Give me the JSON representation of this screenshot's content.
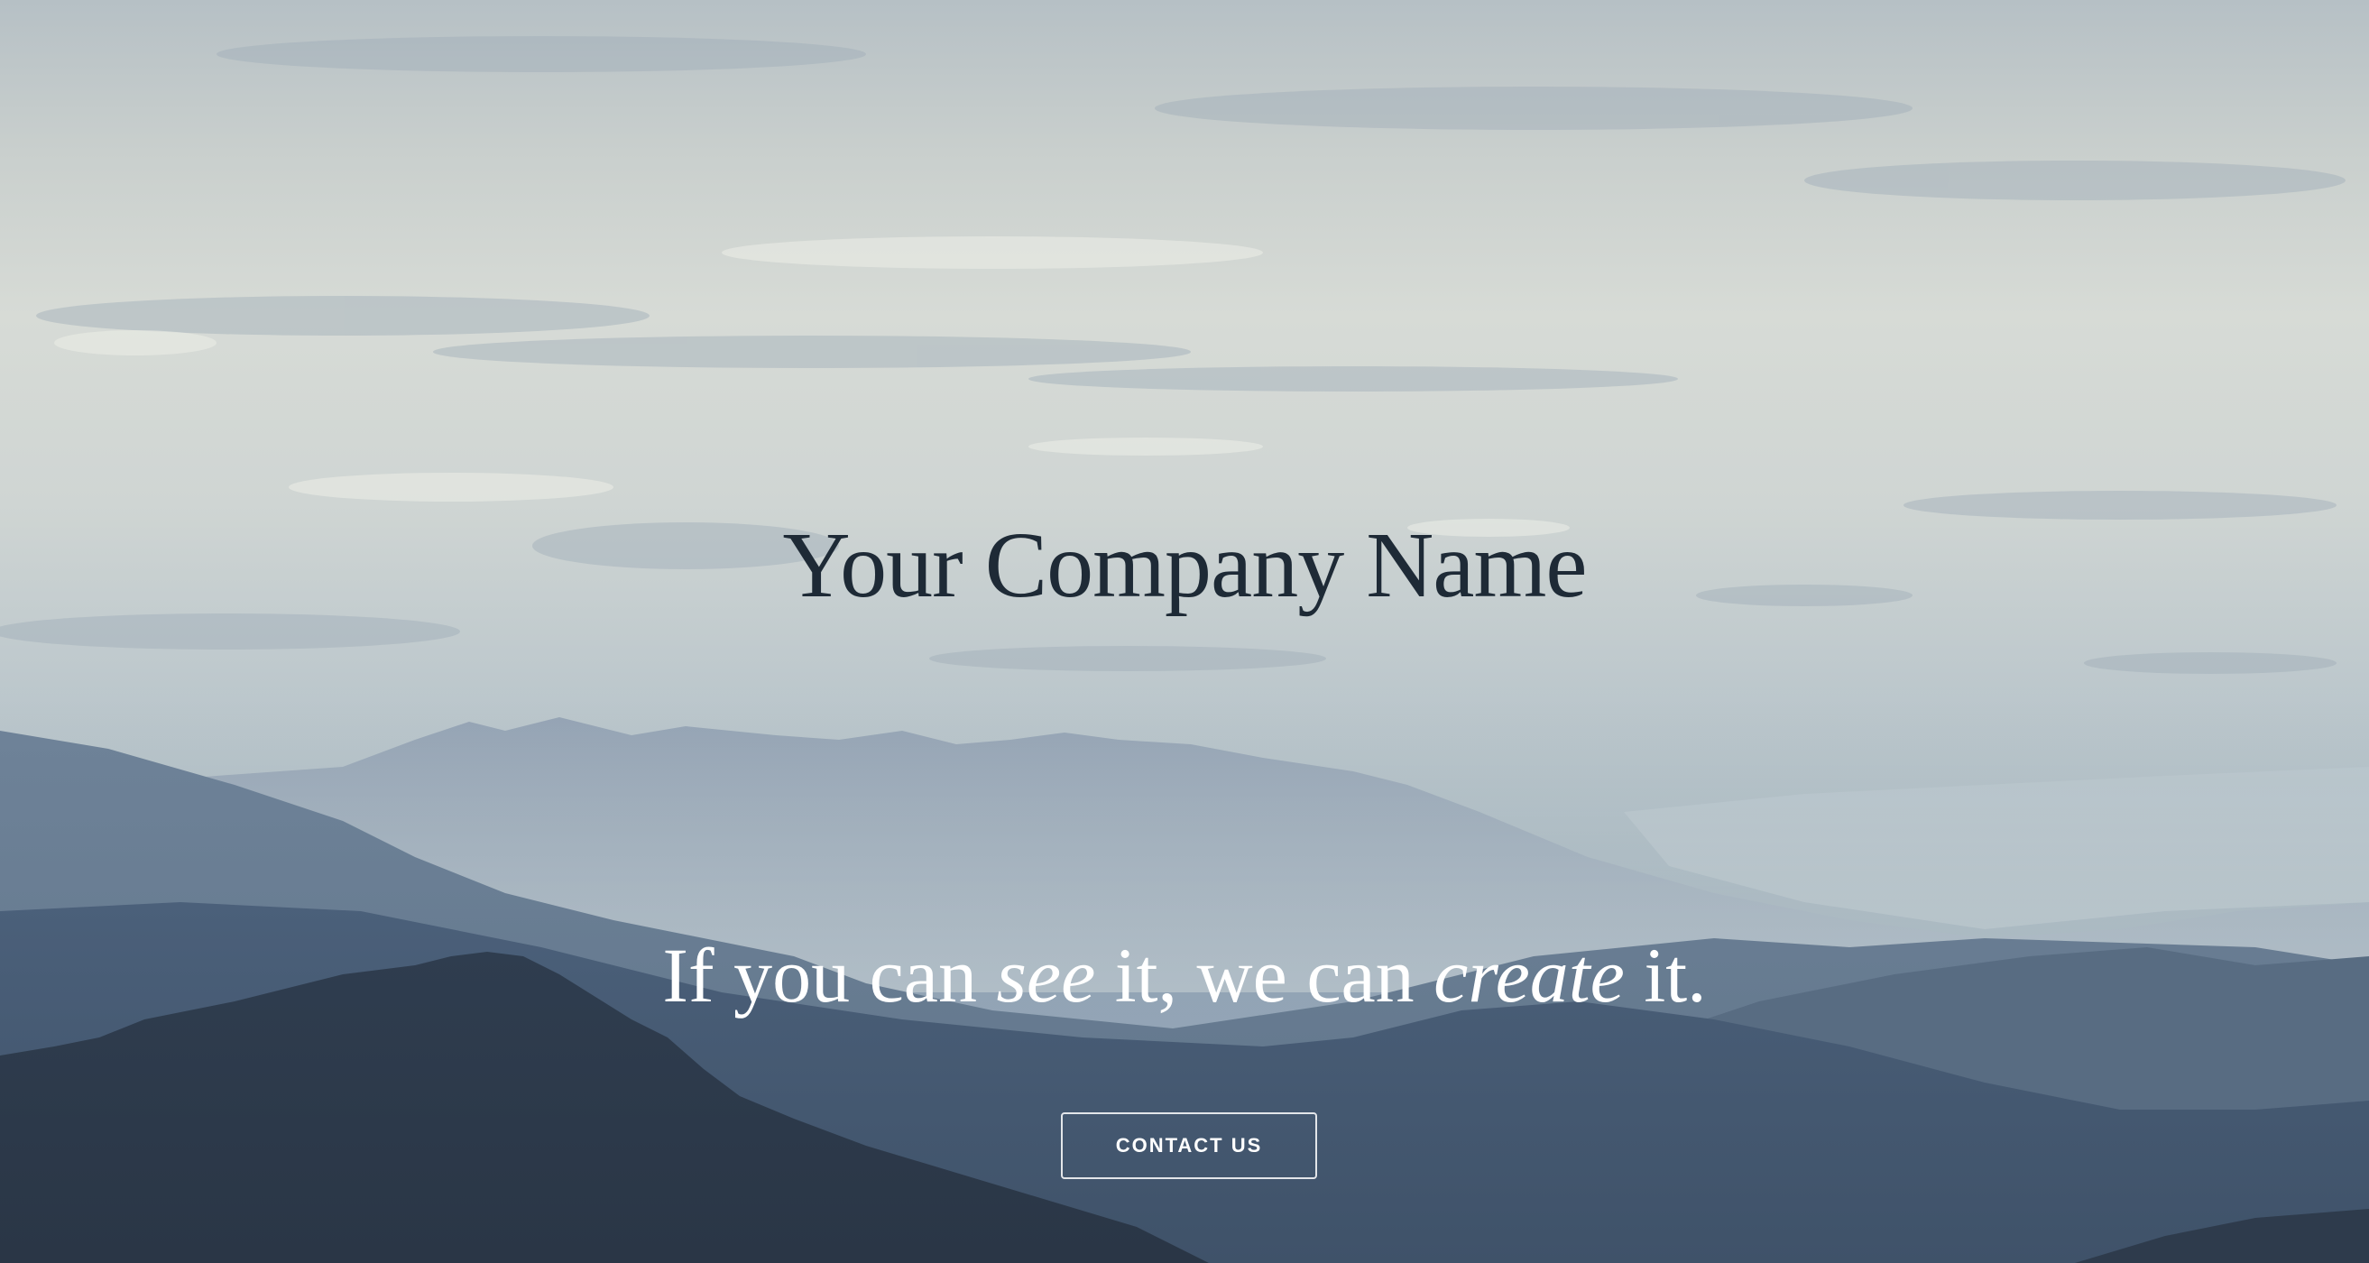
{
  "hero": {
    "title": "Your Company Name",
    "tagline": {
      "part1": "If you can ",
      "emphasis1": "see",
      "part2": " it, we can ",
      "emphasis2": "create",
      "part3": " it."
    },
    "cta_label": "CONTACT US"
  },
  "colors": {
    "title_text": "#1e2a36",
    "tagline_text": "#ffffff",
    "button_border": "#ffffff"
  }
}
